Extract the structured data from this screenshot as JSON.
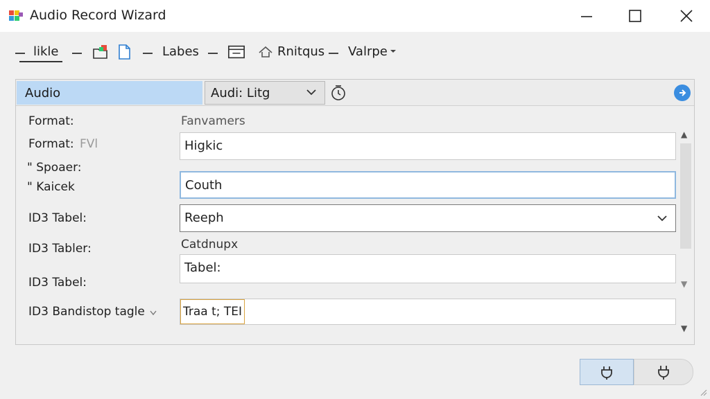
{
  "window": {
    "title": "Audio Record Wizard",
    "icons": {
      "app": "app-icon",
      "minimize": "minimize-icon",
      "maximize": "maximize-icon",
      "close": "close-icon"
    }
  },
  "toolbar": {
    "item1": "likle",
    "item2": "Labes",
    "item3": "Rnitqus",
    "item4": "Valrpe",
    "icons": [
      "folder-new-icon",
      "file-icon",
      "window-icon",
      "home-icon",
      "dropdown-arrow-icon"
    ]
  },
  "panel": {
    "tab_label": "Audio",
    "combo_value": "Audi: Litg",
    "icons": {
      "clock": "clock-icon",
      "go": "forward-circle-icon"
    }
  },
  "form": {
    "format_label": "Format:",
    "parameters_label": "Fanvamers",
    "format2_label": "Format:",
    "format2_suffix": "FVl",
    "field1_value": "Higkic",
    "spoaer_label": "\" Spoaer:",
    "kaicek_label": "\" Kaicek",
    "field2_value": "Couth",
    "id3_tabel_label": "ID3 Tabel:",
    "select_value": "Reeph",
    "id3_tabler_label": "ID3 Tabler:",
    "catdnupx_label": "Catdnupx",
    "id3_tabel2_label": "ID3 Tabel:",
    "field3_value": "Tabel:",
    "id3_band_label": "ID3 Bandistop tagle",
    "field4_value": "Traa t; TEI"
  },
  "colors": {
    "tab_highlight": "#bcd9f5",
    "focus_border": "#8fb8df",
    "accent_blue": "#3a8de0"
  }
}
